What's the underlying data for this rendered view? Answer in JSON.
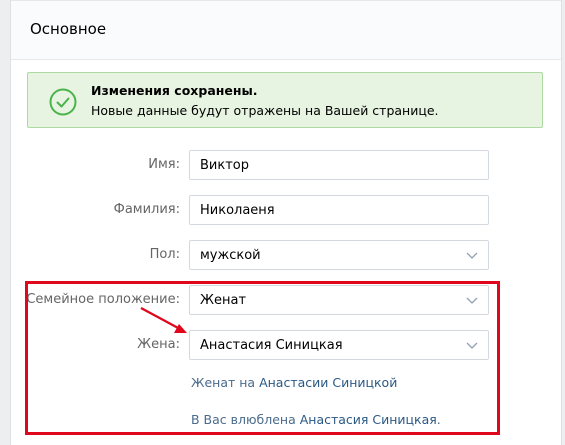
{
  "section": {
    "title": "Основное"
  },
  "notice": {
    "title": "Изменения сохранены.",
    "text": "Новые данные будут отражены на Вашей странице.",
    "icon": "check-circle-icon",
    "color": "#4bb34b"
  },
  "form": {
    "first_name": {
      "label": "Имя:",
      "value": "Виктор"
    },
    "last_name": {
      "label": "Фамилия:",
      "value": "Николаеня"
    },
    "gender": {
      "label": "Пол:",
      "value": "мужской"
    },
    "relationship": {
      "label": "Семейное положение:",
      "value": "Женат"
    },
    "partner": {
      "label": "Жена:",
      "value": "Анастасия Синицкая"
    },
    "married_note": {
      "prefix": "Женат на",
      "link": "Анастасии Синицкой"
    },
    "crush_note": {
      "prefix": "В Вас влюблена",
      "link": "Анастасия Синицкая",
      "suffix": "."
    }
  },
  "annotation": {
    "color": "#e0061b"
  }
}
